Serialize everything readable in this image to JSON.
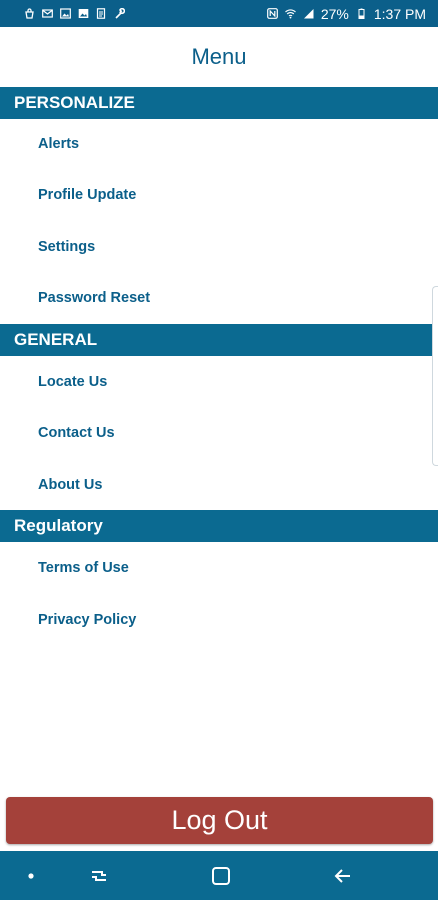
{
  "status_bar": {
    "battery": "27%",
    "time": "1:37 PM",
    "left_icons": [
      "bag-icon",
      "mail-icon",
      "image-icon",
      "gallery-icon",
      "document-icon",
      "wrench-icon"
    ],
    "right_icons": [
      "nfc-icon",
      "wifi-icon",
      "signal-icon",
      "battery-icon"
    ]
  },
  "header": {
    "title": "Menu"
  },
  "sections": [
    {
      "title": "PERSONALIZE",
      "items": [
        "Alerts",
        "Profile Update",
        "Settings",
        "Password Reset"
      ]
    },
    {
      "title": "GENERAL",
      "items": [
        "Locate Us",
        "Contact Us",
        "About Us"
      ]
    },
    {
      "title": "Regulatory",
      "items": [
        "Terms of Use",
        "Privacy Policy"
      ]
    }
  ],
  "logout": {
    "label": "Log Out"
  },
  "nav_bar": {
    "icons": [
      "dot-icon",
      "recent-apps-icon",
      "home-icon",
      "back-icon"
    ]
  },
  "colors": {
    "primary": "#0b6a91",
    "text": "#0b5f8a",
    "logout": "#a4413a",
    "background": "#ffffff"
  }
}
